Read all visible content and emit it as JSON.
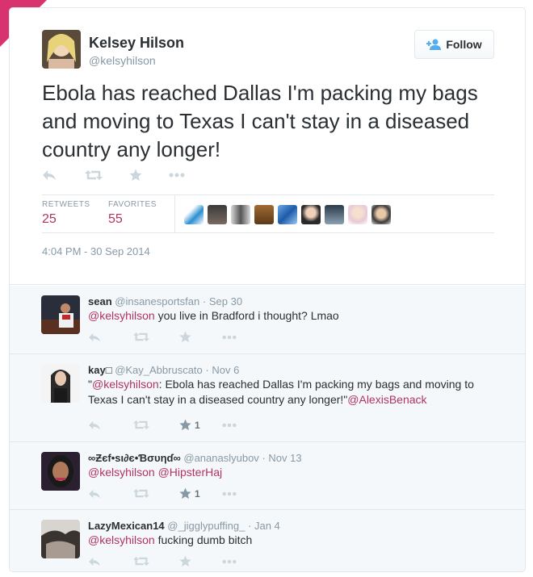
{
  "tweet": {
    "name": "Kelsey Hilson",
    "handle": "@kelsyhilson",
    "text": "Ebola has reached Dallas I'm packing my bags and moving to Texas I can't stay in a diseased country any longer!",
    "retweets_label": "RETWEETS",
    "retweets_count": "25",
    "favorites_label": "FAVORITES",
    "favorites_count": "55",
    "timestamp": "4:04 PM - 30 Sep 2014",
    "follow_label": "Follow"
  },
  "icons": {
    "reply": "reply-icon",
    "retweet": "retweet-icon",
    "favorite": "star-icon",
    "more": "more-icon",
    "follow": "add-user-icon"
  },
  "colors": {
    "accent": "#b03361",
    "muted": "#8899a6",
    "border": "#e1e8ed",
    "reply_bg": "#f5f8fa"
  },
  "replies": [
    {
      "name": "sean",
      "handle": "@insanesportsfan",
      "date": "Sep 30",
      "mention": "@kelsyhilson",
      "text": " you live in Bradford i thought? Lmao"
    },
    {
      "name": "kay",
      "name_icon": "",
      "handle": "@Kay_Abbruscato",
      "date": "Nov 6",
      "quote_open": "\"",
      "mention": "@kelsyhilson",
      "text": ": Ebola has reached Dallas I'm packing my bags and moving to Texas I can't stay in a diseased country any longer!\"",
      "mention2": "@AlexisBenack",
      "fav_count": "1"
    },
    {
      "name": "∞Ƶєf•ѕι∂є•Ɓσυηɗ∞",
      "handle": "@ananaslyubov",
      "date": "Nov 13",
      "mention": "@kelsyhilson",
      "mention2": "@HipsterHaj",
      "fav_count": "1"
    },
    {
      "name": "LazyMexican14",
      "handle": "@_jigglypuffing_",
      "date": "Jan 4",
      "mention": "@kelsyhilson",
      "text": " fucking dumb bitch"
    }
  ]
}
